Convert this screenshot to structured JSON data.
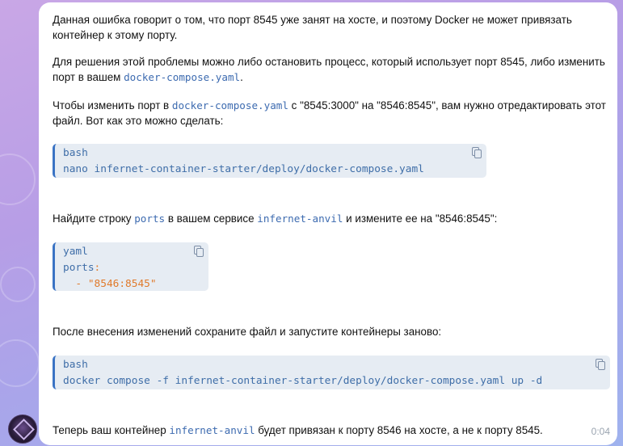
{
  "message": {
    "p1": "Данная ошибка говорит о том, что порт 8545 уже занят на хосте, и поэтому Docker не может привязать контейнер к этому порту.",
    "p2_pre": "Для решения этой проблемы можно либо остановить процесс, который использует порт 8545, либо изменить порт в вашем ",
    "p2_code": "docker-compose.yaml",
    "p2_post": ".",
    "p3_pre": "Чтобы изменить порт в ",
    "p3_code": "docker-compose.yaml",
    "p3_post": " с \"8545:3000\" на \"8546:8545\", вам нужно отредактировать этот файл. Вот как это можно сделать:",
    "p4_pre": "Найдите строку ",
    "p4_code1": "ports",
    "p4_mid": " в вашем сервисе ",
    "p4_code2": "infernet-anvil",
    "p4_post": " и измените ее на \"8546:8545\":",
    "p5": "После внесения изменений сохраните файл и запустите контейнеры заново:",
    "p6_pre": "Теперь ваш контейнер ",
    "p6_code": "infernet-anvil",
    "p6_post": " будет привязан к порту 8546 на хосте, а не к порту 8545.",
    "time": "0:04"
  },
  "code_blocks": {
    "b1": {
      "lang": "bash",
      "kw": "nano",
      "rest": " infernet-container-starter/deploy/docker-compose.yaml"
    },
    "b2": {
      "lang": "yaml",
      "key": "ports",
      "colon": ":",
      "dash": "  - ",
      "val": "\"8546:8545\""
    },
    "b3": {
      "lang": "bash",
      "kw": "docker",
      "rest": " compose -f infernet-container-starter/deploy/docker-compose.yaml up -d"
    }
  },
  "colors": {
    "accent": "#3f6ea8",
    "string": "#e07a2b",
    "code_bg": "#e6ecf3"
  }
}
